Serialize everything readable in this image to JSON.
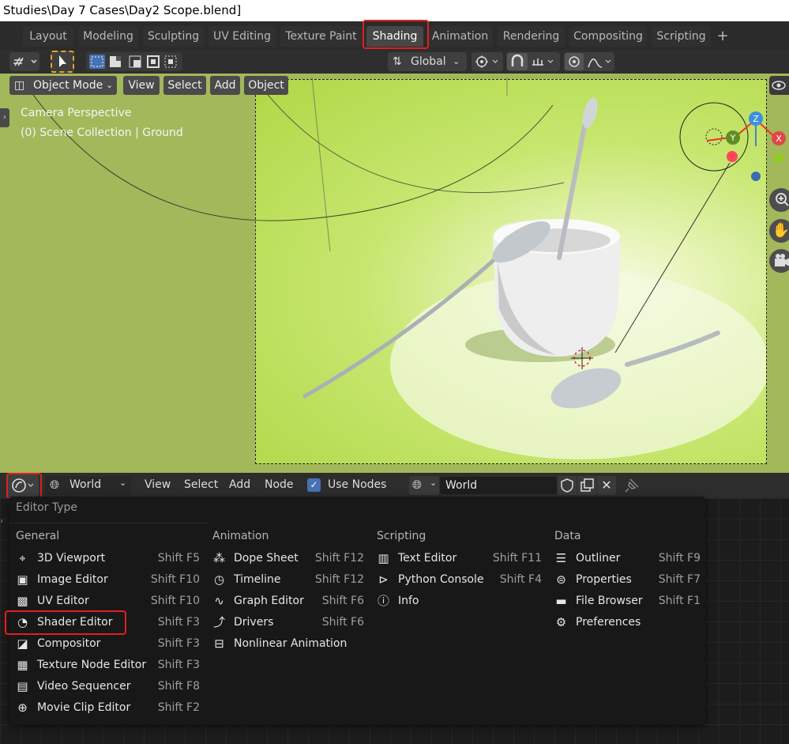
{
  "window_title": "Studies\\Day 7 Cases\\Day2 Scope.blend]",
  "workspace_tabs": [
    "Layout",
    "Modeling",
    "Sculpting",
    "UV Editing",
    "Texture Paint",
    "Shading",
    "Animation",
    "Rendering",
    "Compositing",
    "Scripting"
  ],
  "active_tab": "Shading",
  "add_tab_symbol": "+",
  "viewport_header": {
    "transform_orientation": "Global"
  },
  "viewport": {
    "mode": "Object Mode",
    "menus": [
      "View",
      "Select",
      "Add",
      "Object"
    ],
    "overlay_line1": "Camera Perspective",
    "overlay_line2": "(0) Scene Collection | Ground",
    "gizmo": {
      "z": "Z",
      "y": "Y",
      "x": "X"
    }
  },
  "shader_header": {
    "shader_type": "World",
    "menus": [
      "View",
      "Select",
      "Add",
      "Node"
    ],
    "use_nodes_label": "Use Nodes",
    "use_nodes_checked": true,
    "world_name": "World"
  },
  "editor_type_menu": {
    "title": "Editor Type",
    "columns": [
      {
        "category": "General",
        "items": [
          {
            "label": "3D Viewport",
            "shortcut": "Shift F5",
            "icon": "3d-viewport-icon"
          },
          {
            "label": "Image Editor",
            "shortcut": "Shift F10",
            "icon": "image-editor-icon"
          },
          {
            "label": "UV Editor",
            "shortcut": "Shift F10",
            "icon": "uv-editor-icon"
          },
          {
            "label": "Shader Editor",
            "shortcut": "Shift F3",
            "icon": "shader-editor-icon"
          },
          {
            "label": "Compositor",
            "shortcut": "Shift F3",
            "icon": "compositor-icon"
          },
          {
            "label": "Texture Node Editor",
            "shortcut": "Shift F3",
            "icon": "texture-node-editor-icon"
          },
          {
            "label": "Video Sequencer",
            "shortcut": "Shift F8",
            "icon": "video-sequencer-icon"
          },
          {
            "label": "Movie Clip Editor",
            "shortcut": "Shift F2",
            "icon": "movie-clip-editor-icon"
          }
        ]
      },
      {
        "category": "Animation",
        "items": [
          {
            "label": "Dope Sheet",
            "shortcut": "Shift F12",
            "icon": "dope-sheet-icon"
          },
          {
            "label": "Timeline",
            "shortcut": "Shift F12",
            "icon": "timeline-icon"
          },
          {
            "label": "Graph Editor",
            "shortcut": "Shift F6",
            "icon": "graph-editor-icon"
          },
          {
            "label": "Drivers",
            "shortcut": "Shift F6",
            "icon": "drivers-icon"
          },
          {
            "label": "Nonlinear Animation",
            "shortcut": "",
            "icon": "nonlinear-animation-icon"
          }
        ]
      },
      {
        "category": "Scripting",
        "items": [
          {
            "label": "Text Editor",
            "shortcut": "Shift F11",
            "icon": "text-editor-icon"
          },
          {
            "label": "Python Console",
            "shortcut": "Shift F4",
            "icon": "python-console-icon"
          },
          {
            "label": "Info",
            "shortcut": "",
            "icon": "info-icon"
          }
        ]
      },
      {
        "category": "Data",
        "items": [
          {
            "label": "Outliner",
            "shortcut": "Shift F9",
            "icon": "outliner-icon"
          },
          {
            "label": "Properties",
            "shortcut": "Shift F7",
            "icon": "properties-icon"
          },
          {
            "label": "File Browser",
            "shortcut": "Shift F1",
            "icon": "file-browser-icon"
          },
          {
            "label": "Preferences",
            "shortcut": "",
            "icon": "preferences-icon"
          }
        ]
      }
    ]
  },
  "colors": {
    "highlight_red": "#e02020",
    "viewport_green": "#a3b85b",
    "render_green": "#c6e66e"
  }
}
